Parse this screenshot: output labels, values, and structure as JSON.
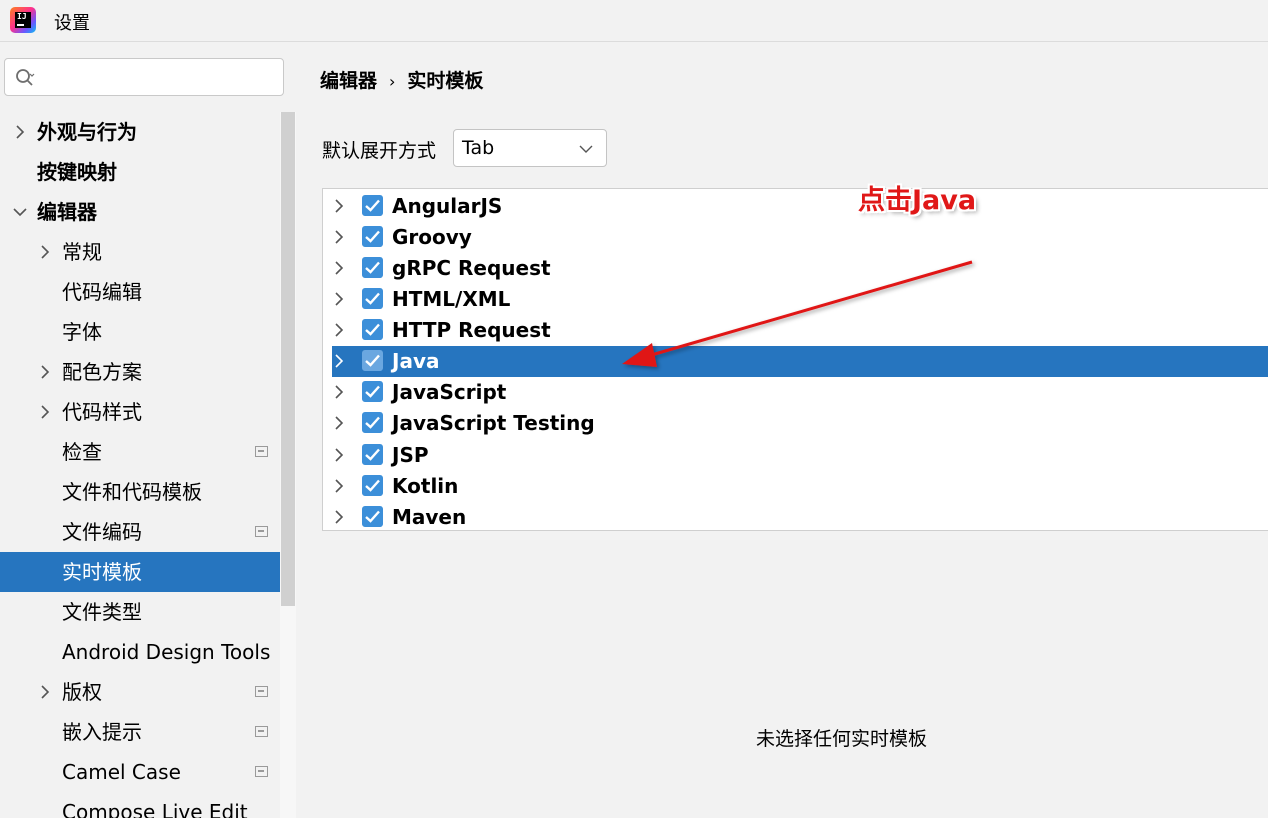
{
  "window": {
    "title": "设置"
  },
  "search": {
    "placeholder": ""
  },
  "sidebar": {
    "items": [
      {
        "label": "外观与行为"
      },
      {
        "label": "按键映射"
      },
      {
        "label": "编辑器"
      },
      {
        "label": "常规"
      },
      {
        "label": "代码编辑"
      },
      {
        "label": "字体"
      },
      {
        "label": "配色方案"
      },
      {
        "label": "代码样式"
      },
      {
        "label": "检查"
      },
      {
        "label": "文件和代码模板"
      },
      {
        "label": "文件编码"
      },
      {
        "label": "实时模板"
      },
      {
        "label": "文件类型"
      },
      {
        "label": "Android Design Tools"
      },
      {
        "label": "版权"
      },
      {
        "label": "嵌入提示"
      },
      {
        "label": "Camel Case"
      },
      {
        "label": "Compose Live Edit"
      }
    ],
    "selected": "实时模板"
  },
  "main": {
    "breadcrumb": [
      "编辑器",
      "实时模板"
    ],
    "breadcrumb_sep": "›",
    "expand_label": "默认展开方式",
    "expand_value": "Tab",
    "tree": [
      {
        "label": "AngularJS",
        "checked": true
      },
      {
        "label": "Groovy",
        "checked": true
      },
      {
        "label": "gRPC Request",
        "checked": true
      },
      {
        "label": "HTML/XML",
        "checked": true
      },
      {
        "label": "HTTP Request",
        "checked": true
      },
      {
        "label": "Java",
        "checked": true
      },
      {
        "label": "JavaScript",
        "checked": true
      },
      {
        "label": "JavaScript Testing",
        "checked": true
      },
      {
        "label": "JSP",
        "checked": true
      },
      {
        "label": "Kotlin",
        "checked": true
      },
      {
        "label": "Maven",
        "checked": true
      }
    ],
    "empty_message": "未选择任何实时模板"
  },
  "annotation": {
    "text": "点击Java",
    "color": "#e01818"
  },
  "colors": {
    "selection": "#2675bf",
    "checkbox": "#3c8fd9"
  },
  "icons": {
    "app": "intellij-logo-icon",
    "search": "search-icon",
    "expand": "chevron-right-icon",
    "expanded": "chevron-down-icon",
    "project": "project-scope-icon"
  }
}
